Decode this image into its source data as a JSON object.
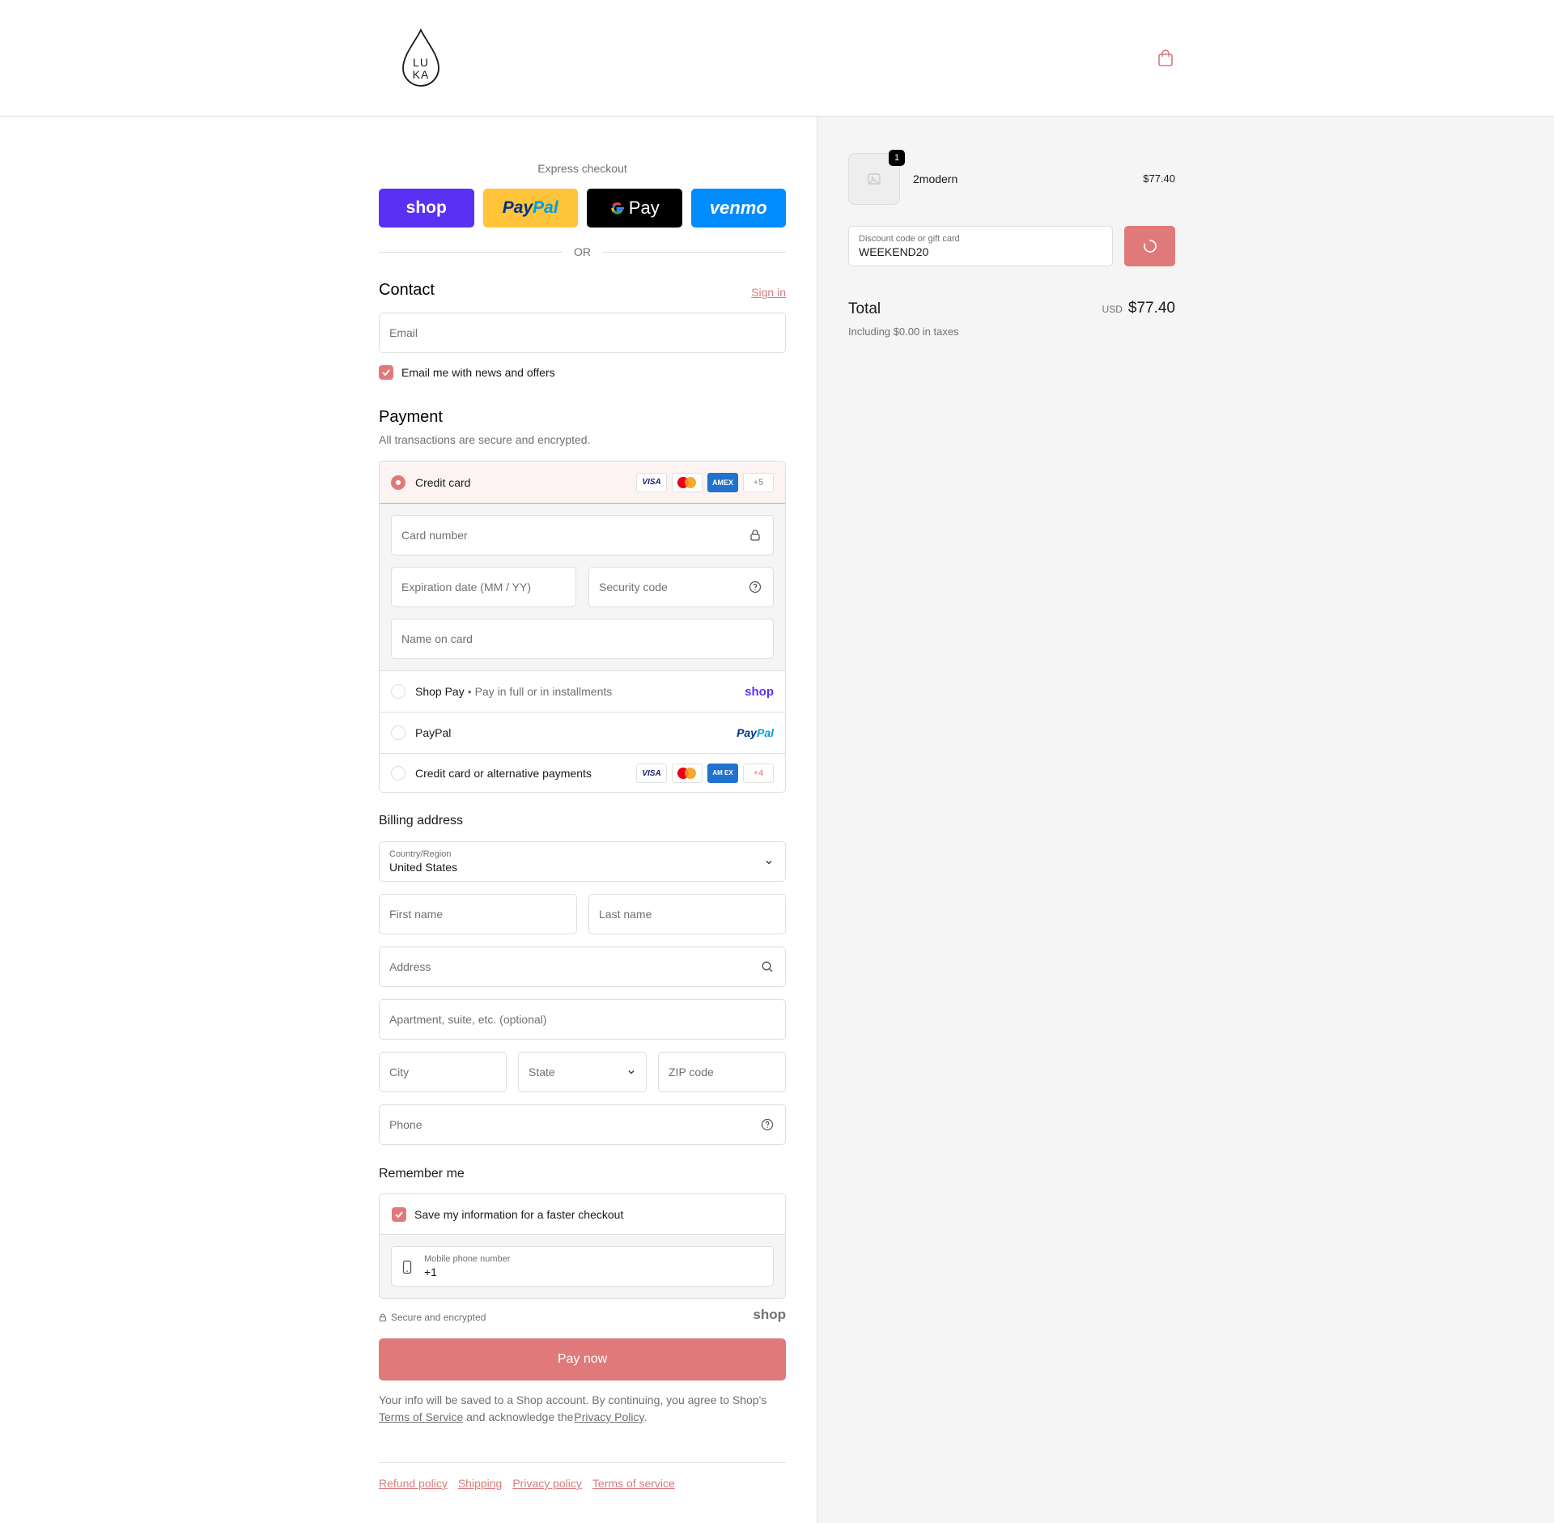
{
  "header": {
    "logo_text": "LU KA",
    "cart_icon": "shopping-bag-icon"
  },
  "express": {
    "title": "Express checkout",
    "shop_label": "shop",
    "paypal_label_a": "Pay",
    "paypal_label_b": "Pal",
    "gpay_label": "Pay",
    "venmo_label": "venmo",
    "or_label": "OR"
  },
  "contact": {
    "title": "Contact",
    "sign_in": "Sign in",
    "email_placeholder": "Email",
    "news_label": "Email me with news and offers"
  },
  "payment": {
    "title": "Payment",
    "subtitle": "All transactions are secure and encrypted.",
    "credit_card_label": "Credit card",
    "brands_more_1": "+5",
    "card_number_placeholder": "Card number",
    "expiry_placeholder": "Expiration date (MM / YY)",
    "security_placeholder": "Security code",
    "name_placeholder": "Name on card",
    "shoppay_label": "Shop Pay",
    "shoppay_sub": "Pay in full or in installments",
    "shoppay_logo": "shop",
    "paypal_label": "PayPal",
    "paypal_logo_a": "Pay",
    "paypal_logo_b": "Pal",
    "alt_label": "Credit card or alternative payments",
    "brands_more_2": "+4",
    "visa": "VISA",
    "amex": "AMEX",
    "amex_split": "AM EX"
  },
  "billing": {
    "title": "Billing address",
    "country_label": "Country/Region",
    "country_value": "United States",
    "first_name": "First name",
    "last_name": "Last name",
    "address": "Address",
    "apartment": "Apartment, suite, etc. (optional)",
    "city": "City",
    "state": "State",
    "zip": "ZIP code",
    "phone": "Phone"
  },
  "remember": {
    "title": "Remember me",
    "save_label": "Save my information for a faster checkout",
    "mobile_label": "Mobile phone number",
    "mobile_value": "+1",
    "secure_label": "Secure and encrypted",
    "shop_logo": "shop"
  },
  "pay_now": "Pay now",
  "legal": {
    "text_a": "Your info will be saved to a Shop account. By continuing, you agree to Shop's",
    "tos": "Terms of Service",
    "text_b": "and acknowledge the",
    "privacy": "Privacy Policy",
    "text_c": "."
  },
  "footer": {
    "links": [
      "Refund policy",
      "Shipping",
      "Privacy policy",
      "Terms of service"
    ]
  },
  "summary": {
    "item_qty": "1",
    "item_name": "2modern",
    "item_price": "$77.40",
    "discount_label": "Discount code or gift card",
    "discount_value": "WEEKEND20",
    "total_label": "Total",
    "currency": "USD",
    "total_value": "$77.40",
    "taxes_note": "Including $0.00 in taxes"
  },
  "colors": {
    "accent": "#e07a7a",
    "shop_purple": "#5a31f4",
    "paypal_yellow": "#ffc439",
    "venmo_blue": "#008cff"
  }
}
